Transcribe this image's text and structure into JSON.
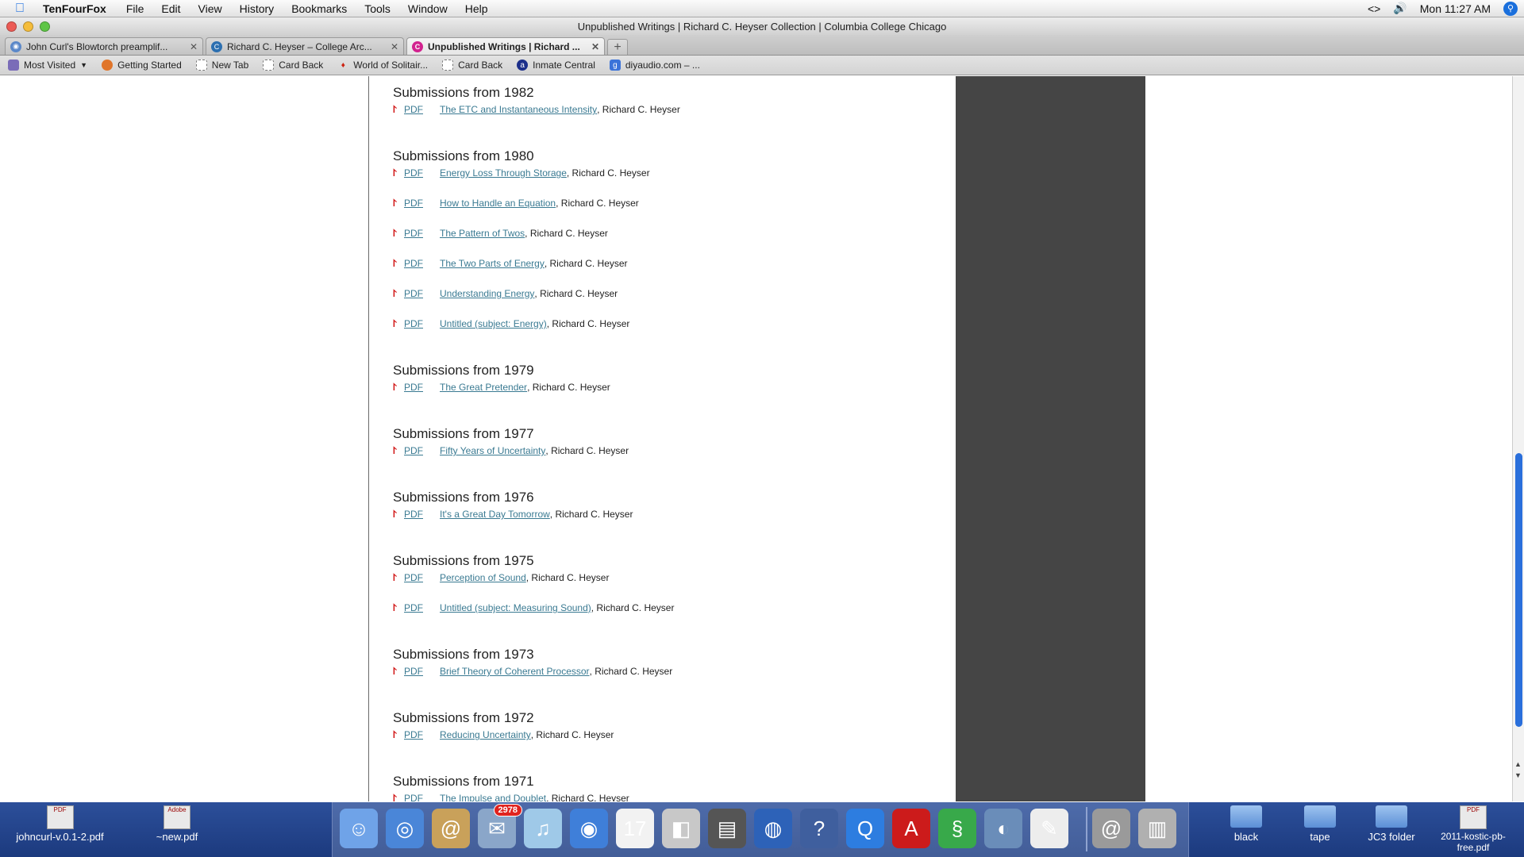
{
  "menubar": {
    "app_name": "TenFourFox",
    "menus": [
      "File",
      "Edit",
      "View",
      "History",
      "Bookmarks",
      "Tools",
      "Window",
      "Help"
    ],
    "status_icons": "<>",
    "clock": "Mon 11:27 AM"
  },
  "window": {
    "title": "Unpublished Writings | Richard C. Heyser Collection | Columbia College Chicago"
  },
  "tabs": [
    {
      "label": "John Curl's Blowtorch preamplif...",
      "favicon": "globe-icon",
      "active": false
    },
    {
      "label": "Richard C. Heyser – College Arc...",
      "favicon": "c-icon",
      "active": false
    },
    {
      "label": "Unpublished Writings | Richard ...",
      "favicon": "c-magenta-icon",
      "active": true
    }
  ],
  "bookmarks": [
    {
      "label": "Most Visited",
      "icon": "folder-icon"
    },
    {
      "label": "Getting Started",
      "icon": "firefox-icon"
    },
    {
      "label": "New Tab",
      "icon": "page-icon"
    },
    {
      "label": "Card Back",
      "icon": "page-icon"
    },
    {
      "label": "World of Solitair...",
      "icon": "cards-icon"
    },
    {
      "label": "Card Back",
      "icon": "page-icon"
    },
    {
      "label": "Inmate Central",
      "icon": "inmate-icon"
    },
    {
      "label": "diyaudio.com – ...",
      "icon": "google-icon"
    }
  ],
  "content": {
    "pdf_label": "PDF",
    "author": ", Richard C. Heyser",
    "sections": [
      {
        "heading": "Submissions from 1982",
        "items": [
          "The ETC and Instantaneous Intensity"
        ]
      },
      {
        "heading": "Submissions from 1980",
        "items": [
          "Energy Loss Through Storage",
          "How to Handle an Equation",
          "The Pattern of Twos",
          "The Two Parts of Energy",
          "Understanding Energy",
          "Untitled (subject: Energy)"
        ]
      },
      {
        "heading": "Submissions from 1979",
        "items": [
          "The Great Pretender"
        ]
      },
      {
        "heading": "Submissions from 1977",
        "items": [
          "Fifty Years of Uncertainty"
        ]
      },
      {
        "heading": "Submissions from 1976",
        "items": [
          "It's a Great Day Tomorrow"
        ]
      },
      {
        "heading": "Submissions from 1975",
        "items": [
          "Perception of Sound",
          "Untitled (subject: Measuring Sound)"
        ]
      },
      {
        "heading": "Submissions from 1973",
        "items": [
          "Brief Theory of Coherent Processor"
        ]
      },
      {
        "heading": "Submissions from 1972",
        "items": [
          "Reducing Uncertainty"
        ]
      },
      {
        "heading": "Submissions from 1971",
        "items": [
          "The Impulse and Doublet"
        ]
      }
    ]
  },
  "desktop": {
    "files": [
      {
        "label": "johncurl-v.0.1-2.pdf",
        "icon_text": "PDF"
      },
      {
        "label": "~new.pdf",
        "icon_text": "Adobe"
      },
      {
        "label": "black"
      },
      {
        "label": "tape"
      },
      {
        "label": "JC3 folder"
      },
      {
        "label": "2011-kostic-pb-free.pdf",
        "icon_text": "PDF"
      }
    ]
  },
  "dock": {
    "apps": [
      {
        "name": "finder-icon",
        "color": "#6fa3e8",
        "glyph": "☺"
      },
      {
        "name": "safari-icon",
        "color": "#4a86d8",
        "glyph": "◎"
      },
      {
        "name": "address-book-icon",
        "color": "#c9a15a",
        "glyph": "@"
      },
      {
        "name": "mail-icon",
        "color": "#8aa6c9",
        "glyph": "✉",
        "badge": "2978"
      },
      {
        "name": "itunes-icon",
        "color": "#9fc9e8",
        "glyph": "♫"
      },
      {
        "name": "ichat-icon",
        "color": "#3f7fd9",
        "glyph": "◉"
      },
      {
        "name": "ical-icon",
        "color": "#f2f2f2",
        "glyph": "17"
      },
      {
        "name": "ipod-utility-icon",
        "color": "#c8c8c8",
        "glyph": "◧"
      },
      {
        "name": "printer-icon",
        "color": "#555555",
        "glyph": "▤"
      },
      {
        "name": "network-globe-icon",
        "color": "#2d62b8",
        "glyph": "◍"
      },
      {
        "name": "help-icon",
        "color": "#3f5f9e",
        "glyph": "?"
      },
      {
        "name": "quicktime-icon",
        "color": "#2d7de0",
        "glyph": "Q"
      },
      {
        "name": "acrobat-icon",
        "color": "#cc1b1b",
        "glyph": "A"
      },
      {
        "name": "autocad-icon",
        "color": "#38a94a",
        "glyph": "§"
      },
      {
        "name": "iphoto-icon",
        "color": "#6a8db9",
        "glyph": "◐"
      },
      {
        "name": "textedit-icon",
        "color": "#ededed",
        "glyph": "✎"
      },
      {
        "name": "downloads-icon",
        "color": "#9a9a9a",
        "glyph": "@"
      },
      {
        "name": "trash-icon",
        "color": "#b0b0b0",
        "glyph": "▥"
      }
    ]
  }
}
